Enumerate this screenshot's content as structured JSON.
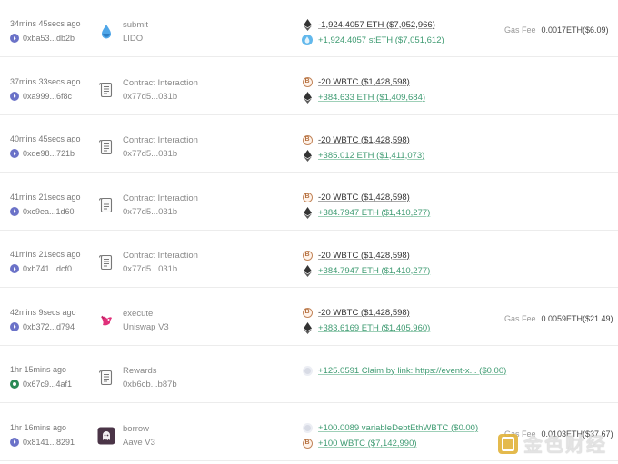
{
  "rows": [
    {
      "time": "34mins 45secs ago",
      "addr": "0xba53...db2b",
      "addr_badge": "eth",
      "icon": "lido-drop-icon",
      "title": "submit",
      "sub": "LIDO",
      "transfers": [
        {
          "token": "eth",
          "dir": "neg",
          "text": "-1,924.4057 ETH ($7,052,966)"
        },
        {
          "token": "steth",
          "dir": "pos",
          "text": "+1,924.4057 stETH ($7,051,612)"
        }
      ],
      "gas_label": "Gas Fee",
      "gas_value": "0.0017ETH($6.09)"
    },
    {
      "time": "37mins 33secs ago",
      "addr": "0xa999...6f8c",
      "addr_badge": "eth",
      "icon": "contract-scroll-icon",
      "title": "Contract Interaction",
      "sub": "0x77d5...031b",
      "transfers": [
        {
          "token": "wbtc",
          "dir": "neg",
          "text": "-20 WBTC ($1,428,598)"
        },
        {
          "token": "eth",
          "dir": "pos",
          "text": "+384.633 ETH ($1,409,684)"
        }
      ]
    },
    {
      "time": "40mins 45secs ago",
      "addr": "0xde98...721b",
      "addr_badge": "eth",
      "icon": "contract-scroll-icon",
      "title": "Contract Interaction",
      "sub": "0x77d5...031b",
      "transfers": [
        {
          "token": "wbtc",
          "dir": "neg",
          "text": "-20 WBTC ($1,428,598)"
        },
        {
          "token": "eth",
          "dir": "pos",
          "text": "+385.012 ETH ($1,411,073)"
        }
      ]
    },
    {
      "time": "41mins 21secs ago",
      "addr": "0xc9ea...1d60",
      "addr_badge": "eth",
      "icon": "contract-scroll-icon",
      "title": "Contract Interaction",
      "sub": "0x77d5...031b",
      "transfers": [
        {
          "token": "wbtc",
          "dir": "neg",
          "text": "-20 WBTC ($1,428,598)"
        },
        {
          "token": "eth",
          "dir": "pos",
          "text": "+384.7947 ETH ($1,410,277)"
        }
      ]
    },
    {
      "time": "41mins 21secs ago",
      "addr": "0xb741...dcf0",
      "addr_badge": "eth",
      "icon": "contract-scroll-icon",
      "title": "Contract Interaction",
      "sub": "0x77d5...031b",
      "transfers": [
        {
          "token": "wbtc",
          "dir": "neg",
          "text": "-20 WBTC ($1,428,598)"
        },
        {
          "token": "eth",
          "dir": "pos",
          "text": "+384.7947 ETH ($1,410,277)"
        }
      ]
    },
    {
      "time": "42mins 9secs ago",
      "addr": "0xb372...d794",
      "addr_badge": "eth",
      "icon": "uniswap-unicorn-icon",
      "title": "execute",
      "sub": "Uniswap V3",
      "transfers": [
        {
          "token": "wbtc",
          "dir": "neg",
          "text": "-20 WBTC ($1,428,598)"
        },
        {
          "token": "eth",
          "dir": "pos",
          "text": "+383.6169 ETH ($1,405,960)"
        }
      ],
      "gas_label": "Gas Fee",
      "gas_value": "0.0059ETH($21.49)"
    },
    {
      "time": "1hr 15mins ago",
      "addr": "0x67c9...4af1",
      "addr_badge": "green",
      "icon": "contract-scroll-icon",
      "title": "Rewards",
      "sub": "0xb6cb...b87b",
      "transfers": [
        {
          "token": "gray",
          "dir": "pos",
          "text": "+125.0591 Claim by link: https://event-x...  ($0.00)"
        }
      ]
    },
    {
      "time": "1hr 16mins ago",
      "addr": "0x8141...8291",
      "addr_badge": "eth",
      "icon": "aave-ghost-icon",
      "title": "borrow",
      "sub": "Aave V3",
      "transfers": [
        {
          "token": "gray",
          "dir": "pos",
          "text": "+100.0089 variableDebtEthWBTC ($0.00)"
        },
        {
          "token": "wbtc",
          "dir": "pos",
          "text": "+100 WBTC ($7,142,990)"
        }
      ],
      "gas_label": "Gas Fee",
      "gas_value": "0.0103ETH($37.67)"
    }
  ],
  "watermark": {
    "text": "金色财经",
    "icon": "jinse-logo-icon"
  }
}
